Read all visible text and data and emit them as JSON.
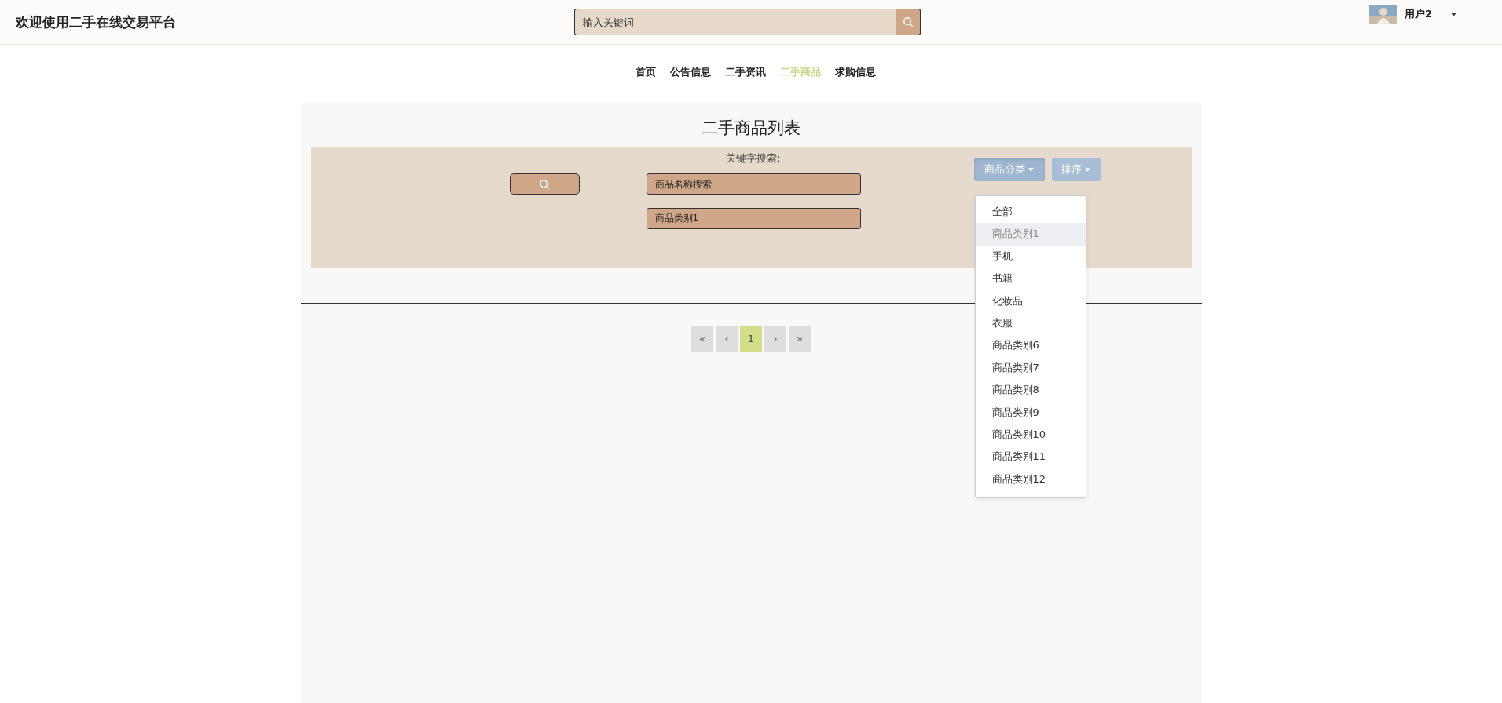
{
  "header": {
    "title": "欢迎使用二手在线交易平台",
    "search": {
      "placeholder": "输入关键词"
    },
    "user": {
      "name": "用户2"
    }
  },
  "nav": [
    {
      "label": "首页",
      "selected": false
    },
    {
      "label": "公告信息",
      "selected": false
    },
    {
      "label": "二手资讯",
      "selected": false
    },
    {
      "label": "二手商品",
      "selected": true
    },
    {
      "label": "求购信息",
      "selected": false
    }
  ],
  "panel": {
    "title": "二手商品列表",
    "search_label": "关键字搜索:",
    "name_field": {
      "placeholder": "商品名称搜索"
    },
    "category_field": {
      "value": "商品类别1"
    },
    "category_button": {
      "label": "商品分类",
      "expanded": true
    },
    "sort_button": {
      "label": "排序"
    },
    "category_menu": [
      {
        "label": "全部",
        "selected": false
      },
      {
        "label": "商品类别1",
        "selected": true
      },
      {
        "label": "手机",
        "selected": false
      },
      {
        "label": "书籍",
        "selected": false
      },
      {
        "label": "化妆品",
        "selected": false
      },
      {
        "label": "衣服",
        "selected": false
      },
      {
        "label": "商品类别6",
        "selected": false
      },
      {
        "label": "商品类别7",
        "selected": false
      },
      {
        "label": "商品类别8",
        "selected": false
      },
      {
        "label": "商品类别9",
        "selected": false
      },
      {
        "label": "商品类别10",
        "selected": false
      },
      {
        "label": "商品类别11",
        "selected": false
      },
      {
        "label": "商品类别12",
        "selected": false
      }
    ]
  },
  "pagination": [
    {
      "label": "«",
      "selected": false
    },
    {
      "label": "‹",
      "selected": false
    },
    {
      "label": "1",
      "selected": true
    },
    {
      "label": "›",
      "selected": false
    },
    {
      "label": "»",
      "selected": false
    }
  ]
}
